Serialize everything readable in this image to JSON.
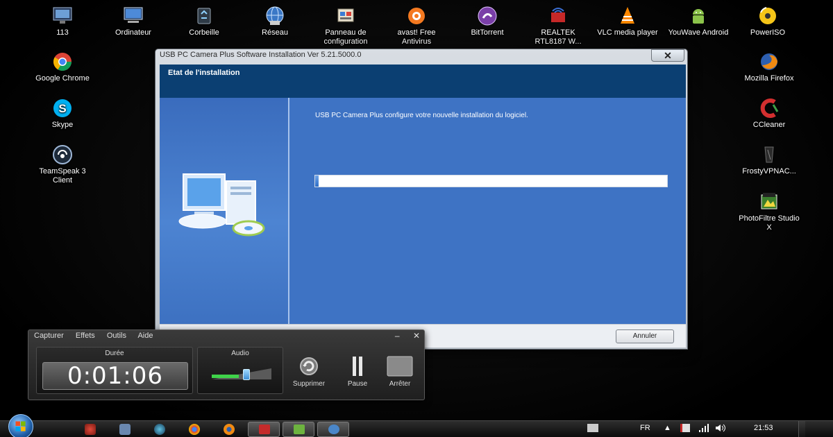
{
  "desktop": {
    "left_icons": [
      {
        "label": "113",
        "icon": "monitor-icon"
      },
      {
        "label": "Google Chrome",
        "icon": "chrome-icon"
      },
      {
        "label": "Skype",
        "icon": "skype-icon"
      },
      {
        "label": "TeamSpeak 3 Client",
        "icon": "teamspeak-icon"
      }
    ],
    "top_icons": [
      {
        "label": "Ordinateur",
        "icon": "computer-icon"
      },
      {
        "label": "Corbeille",
        "icon": "recycle-bin-icon"
      },
      {
        "label": "Réseau",
        "icon": "network-icon"
      },
      {
        "label": "Panneau de configuration",
        "icon": "control-panel-icon"
      },
      {
        "label": "avast! Free Antivirus",
        "icon": "avast-icon"
      },
      {
        "label": "BitTorrent",
        "icon": "bittorrent-icon"
      },
      {
        "label": "REALTEK RTL8187 W...",
        "icon": "realtek-icon"
      },
      {
        "label": "VLC media player",
        "icon": "vlc-icon"
      },
      {
        "label": "YouWave Android",
        "icon": "android-icon"
      },
      {
        "label": "PowerISO",
        "icon": "poweriso-icon"
      }
    ],
    "right_icons": [
      {
        "label": "Mozilla Firefox",
        "icon": "firefox-icon"
      },
      {
        "label": "CCleaner",
        "icon": "ccleaner-icon"
      },
      {
        "label": "FrostyVPNAC...",
        "icon": "frostyvpn-icon"
      },
      {
        "label": "PhotoFiltre Studio X",
        "icon": "photofiltre-icon"
      }
    ]
  },
  "installer": {
    "title": "USB PC Camera Plus Software Installation Ver 5.21.5000.0",
    "close_label": "✕",
    "header": "Etat de l'installation",
    "message": "USB PC Camera Plus configure votre nouvelle installation du logiciel.",
    "progress": 0.01,
    "cancel_label": "Annuler"
  },
  "recorder": {
    "menu": [
      "Capturer",
      "Effets",
      "Outils",
      "Aide"
    ],
    "minimize_label": "–",
    "close_label": "✕",
    "duration_label": "Durée",
    "duration": "0:01:06",
    "audio_label": "Audio",
    "audio_level": 0.45,
    "controls": [
      {
        "label": "Supprimer",
        "icon": "delete-icon"
      },
      {
        "label": "Pause",
        "icon": "pause-icon"
      },
      {
        "label": "Arrêter",
        "icon": "stop-icon"
      }
    ]
  },
  "taskbar": {
    "language": "FR",
    "clock": "21:53"
  }
}
